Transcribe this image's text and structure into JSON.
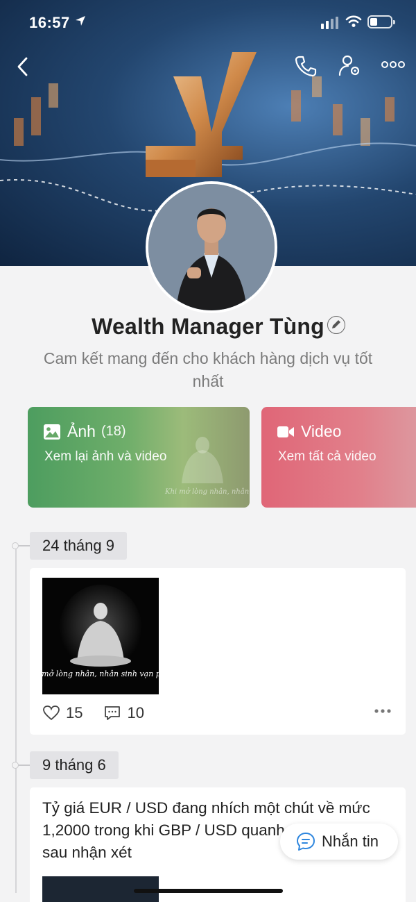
{
  "status_bar": {
    "time": "16:57"
  },
  "profile": {
    "name": "Wealth Manager Tùng",
    "bio": "Cam kết mang đến cho khách hàng dịch vụ tốt nhất"
  },
  "media_cards": {
    "photos": {
      "title": "Ảnh",
      "count": "(18)",
      "subtitle": "Xem lại ảnh và video",
      "thumb_text": "Khi mở lòng nhân, nhân sinh vạn phúc"
    },
    "videos": {
      "title": "Video",
      "subtitle": "Xem tất cả video"
    }
  },
  "timeline": [
    {
      "date": "24 tháng 9",
      "image_caption": "Khi mở lòng nhân, nhân sinh vạn phúc",
      "likes": "15",
      "comments": "10"
    },
    {
      "date": "9 tháng 6",
      "text": "Tỷ giá EUR / USD đang nhích một chút về mức 1,2000 trong khi GBP / USD quanh mức 1,4170 sau nhận xét"
    }
  ],
  "message_button": {
    "label": "Nhắn tin"
  },
  "icons": [
    "back-icon",
    "phone-icon",
    "user-settings-icon",
    "more-icon",
    "edit-icon",
    "image-icon",
    "video-icon",
    "heart-icon",
    "comment-icon",
    "chat-icon"
  ],
  "colors": {
    "photo_card": "#5fa565",
    "video_card": "#e06677",
    "message_accent": "#2e86de"
  }
}
